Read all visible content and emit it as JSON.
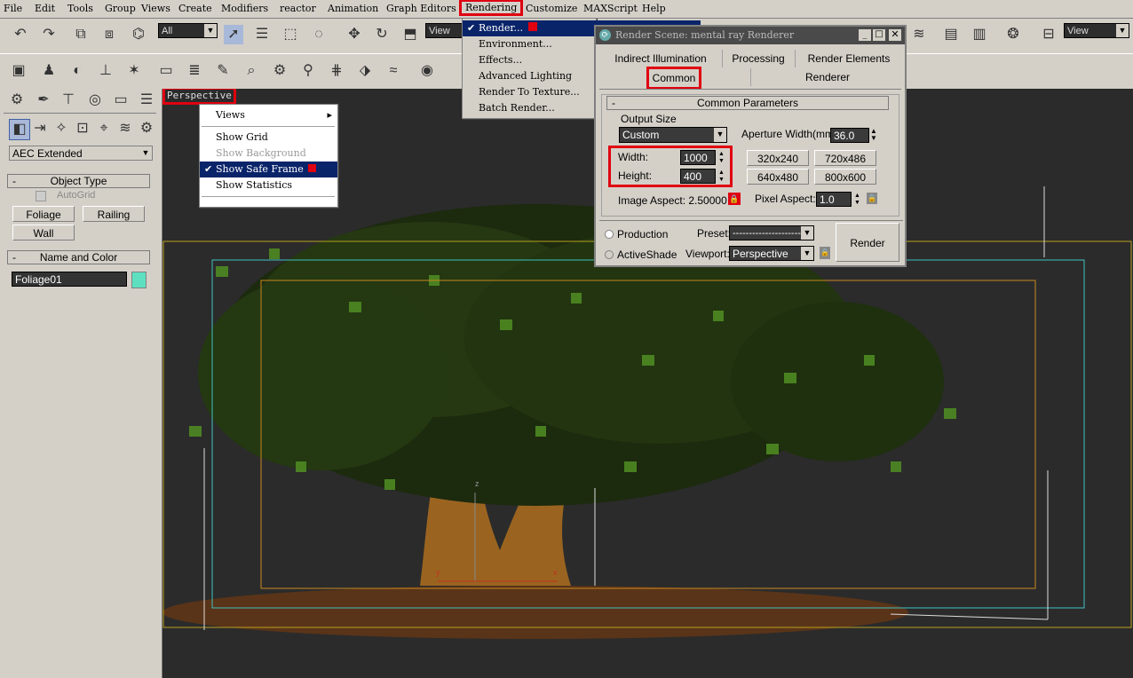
{
  "menubar": {
    "items": [
      "File",
      "Edit",
      "Tools",
      "Group",
      "Views",
      "Create",
      "Modifiers",
      "reactor",
      "Animation",
      "Graph Editors",
      "Rendering",
      "Customize",
      "MAXScript",
      "Help"
    ]
  },
  "toolbar1": {
    "selection_filter": "All",
    "ref_coord": "View",
    "ref_coord_right": "View"
  },
  "leftpanel": {
    "category_dropdown": "AEC Extended",
    "object_type_header": "Object Type",
    "autogrid_label": "AutoGrid",
    "buttons": [
      "Foliage",
      "Railing",
      "Wall"
    ],
    "name_color_header": "Name and Color",
    "object_name": "Foliage01",
    "object_color": "#5ee0c0"
  },
  "viewport": {
    "label": "Perspective",
    "axis_x": "x",
    "axis_y": "y",
    "axis_z": "z"
  },
  "context_menu": {
    "items": [
      "Views",
      "Show Grid",
      "Show Background",
      "Show Safe Frame",
      "Show Statistics"
    ]
  },
  "rendering_menu": {
    "items": [
      "Render...",
      "Environment...",
      "Effects...",
      "Advanced Lighting",
      "Render To Texture...",
      "Batch Render..."
    ]
  },
  "dialog": {
    "title": "Render Scene: mental ray Renderer",
    "tabs_row1": [
      "Indirect Illumination",
      "Processing",
      "Render Elements"
    ],
    "tabs_row2": [
      "Common",
      "Renderer"
    ],
    "section_header": "Common Parameters",
    "output_size_label": "Output Size",
    "output_size_value": "Custom",
    "aperture_label": "Aperture Width(mm):",
    "aperture_value": "36.0",
    "width_label": "Width:",
    "width_value": "1000",
    "height_label": "Height:",
    "height_value": "400",
    "presets": [
      "320x240",
      "720x486",
      "640x480",
      "800x600"
    ],
    "image_aspect": "Image Aspect: 2.50000",
    "pixel_aspect_label": "Pixel Aspect:",
    "pixel_aspect_value": "1.0",
    "production_label": "Production",
    "activeshade_label": "ActiveShade",
    "preset_label": "Preset:",
    "preset_value": "-------------------------",
    "viewport_label": "Viewport:",
    "viewport_value": "Perspective",
    "render_button": "Render"
  }
}
